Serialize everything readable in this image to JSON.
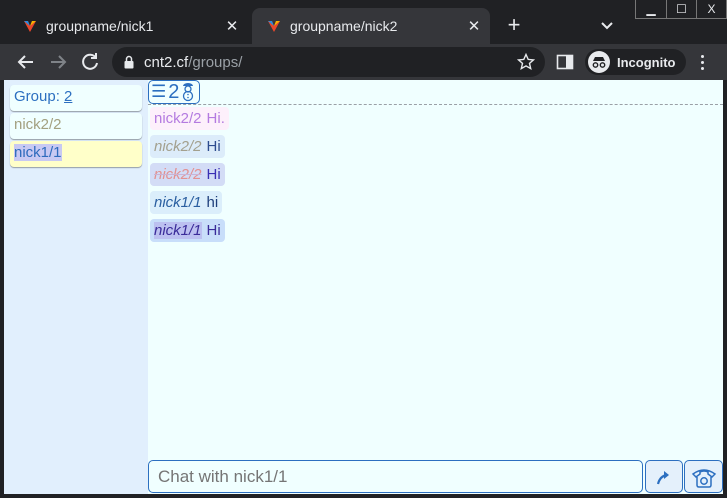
{
  "browser": {
    "tabs": [
      {
        "title": "groupname/nick1",
        "active": false
      },
      {
        "title": "groupname/nick2",
        "active": true
      }
    ],
    "new_tab_label": "+",
    "url_host": "cnt2.cf",
    "url_path": "/groups/",
    "incognito_label": "Incognito",
    "window_controls": {
      "minimize": "▁",
      "maximize": "☐",
      "close": "X"
    }
  },
  "sidebar": {
    "group_label": "Group: ",
    "group_count": "2",
    "members": [
      "nick2/2",
      "nick1/1"
    ]
  },
  "chat": {
    "header_count": "2",
    "messages": [
      {
        "nick": "nick2/2",
        "text": "Hi."
      },
      {
        "nick": "nick2/2",
        "text": "Hi"
      },
      {
        "nick": "nick2/2",
        "text": "Hi"
      },
      {
        "nick": "nick1/1",
        "text": "hi"
      },
      {
        "nick": "nick1/1",
        "text": "Hi"
      }
    ],
    "input_placeholder": "Chat with nick1/1"
  },
  "colors": {
    "accent": "#2c6fc0",
    "sidebar_bg": "#e1effd",
    "chat_bg": "#f0ffff",
    "browser_dark": "#202124",
    "browser_toolbar": "#35363a"
  }
}
